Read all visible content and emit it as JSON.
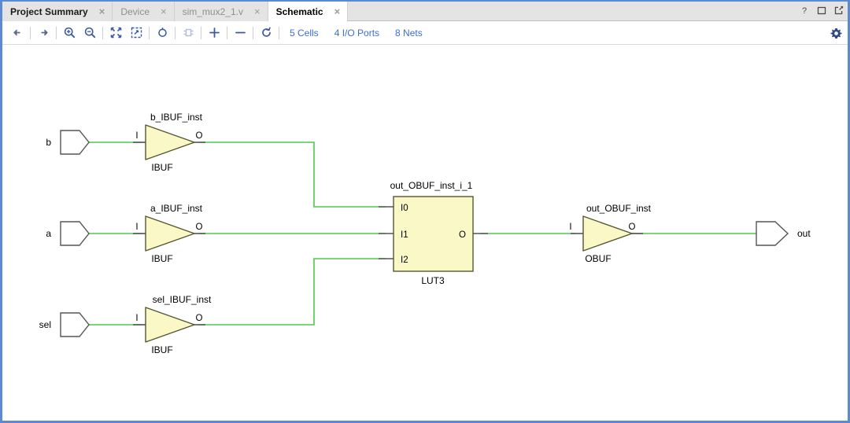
{
  "window": {
    "controls": [
      {
        "name": "help-button",
        "glyph": "?"
      },
      {
        "name": "maximize-button",
        "glyph": "□"
      },
      {
        "name": "float-button",
        "glyph": "⧉"
      }
    ]
  },
  "tabs": [
    {
      "label": "Project Summary",
      "state": "inactive-strong",
      "close": "×"
    },
    {
      "label": "Device",
      "state": "inactive-dim",
      "close": "×"
    },
    {
      "label": "sim_mux2_1.v",
      "state": "inactive-dim",
      "close": "×"
    },
    {
      "label": "Schematic",
      "state": "active",
      "close": "×"
    }
  ],
  "toolbar": {
    "buttons": [
      {
        "name": "back-icon",
        "title": "Back"
      },
      {
        "name": "forward-icon",
        "title": "Forward"
      },
      {
        "name": "zoom-in-icon",
        "title": "Zoom In"
      },
      {
        "name": "zoom-out-icon",
        "title": "Zoom Out"
      },
      {
        "name": "zoom-fit-icon",
        "title": "Zoom Fit"
      },
      {
        "name": "zoom-area-icon",
        "title": "Zoom Area"
      },
      {
        "name": "refresh-schematic-icon",
        "title": "Refresh"
      },
      {
        "name": "expand-cell-icon",
        "title": "Expand Cell"
      },
      {
        "name": "add-selected-icon",
        "title": "Add Selected"
      },
      {
        "name": "remove-selected-icon",
        "title": "Remove Selected"
      },
      {
        "name": "regenerate-icon",
        "title": "Regenerate Layout"
      }
    ],
    "links": [
      {
        "name": "cells-count-link",
        "label": "5 Cells"
      },
      {
        "name": "io-ports-count-link",
        "label": "4 I/O Ports"
      },
      {
        "name": "nets-count-link",
        "label": "8 Nets"
      }
    ],
    "settings": {
      "name": "gear-icon",
      "label": "Settings"
    }
  },
  "schematic": {
    "ports_in": [
      {
        "name": "b",
        "label": "b"
      },
      {
        "name": "a",
        "label": "a"
      },
      {
        "name": "sel",
        "label": "sel"
      }
    ],
    "ports_out": [
      {
        "name": "out",
        "label": "out"
      }
    ],
    "buffers": [
      {
        "instance": "b_IBUF_inst",
        "type": "IBUF",
        "pin_in": "I",
        "pin_out": "O"
      },
      {
        "instance": "a_IBUF_inst",
        "type": "IBUF",
        "pin_in": "I",
        "pin_out": "O"
      },
      {
        "instance": "sel_IBUF_inst",
        "type": "IBUF",
        "pin_in": "I",
        "pin_out": "O"
      },
      {
        "instance": "out_OBUF_inst",
        "type": "OBUF",
        "pin_in": "I",
        "pin_out": "O"
      }
    ],
    "lut": {
      "instance": "out_OBUF_inst_i_1",
      "type": "LUT3",
      "inputs": [
        "I0",
        "I1",
        "I2"
      ],
      "output": "O"
    },
    "colors": {
      "net": "#4ec94e",
      "cell_fill": "#fbf8c8",
      "cell_stroke": "#555533",
      "pin_stub": "#555555",
      "port_stroke": "#555555"
    }
  }
}
